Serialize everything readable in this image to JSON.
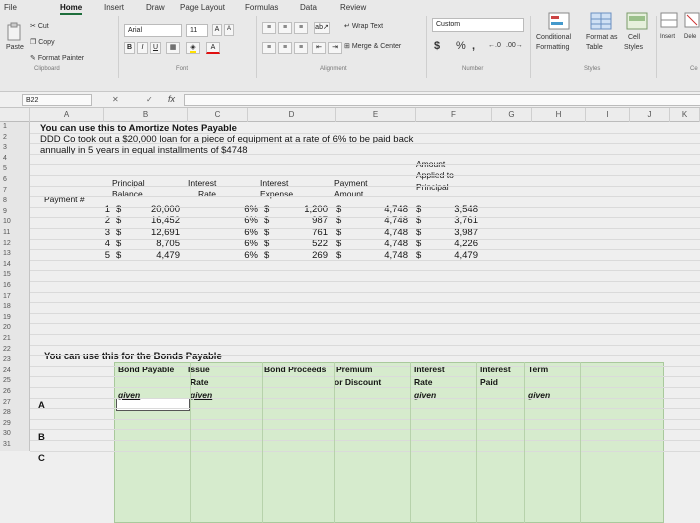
{
  "ribbon": {
    "tabs": [
      {
        "label": "File"
      },
      {
        "label": "Home"
      },
      {
        "label": "Insert"
      },
      {
        "label": "Draw"
      },
      {
        "label": "Page Layout"
      },
      {
        "label": "Formulas"
      },
      {
        "label": "Data"
      },
      {
        "label": "Review"
      }
    ],
    "clipboard": {
      "paste": "Paste",
      "cut": "Cut",
      "copy": "Copy",
      "format_painter": "Format Painter",
      "group": "Clipboard"
    },
    "font": {
      "name": "Arial",
      "size": "11",
      "bold": "B",
      "italic": "I",
      "underline": "U",
      "grow": "A",
      "shrink": "A",
      "color": "A",
      "group": "Font"
    },
    "alignment": {
      "wrap": "Wrap Text",
      "merge": "Merge & Center",
      "group": "Alignment"
    },
    "number": {
      "format": "Custom",
      "currency": "$",
      "percent": "%",
      "comma": ",",
      "group": "Number"
    },
    "styles": {
      "conditional_line1": "Conditional",
      "conditional_line2": "Formatting",
      "format_as_table_line1": "Format as",
      "format_as_table_line2": "Table",
      "cell_line1": "Cell",
      "cell_line2": "Styles",
      "group": "Styles"
    },
    "cells": {
      "insert": "Insert",
      "delete": "Dele",
      "ce": "Ce"
    }
  },
  "formula_bar": {
    "name_box": "B22",
    "fx": "fx",
    "cancel": "✕",
    "enter": "✓"
  },
  "columns": [
    "A",
    "B",
    "C",
    "D",
    "E",
    "F",
    "G",
    "H",
    "I",
    "J",
    "K"
  ],
  "rows": [
    "1",
    "2",
    "3",
    "4",
    "5",
    "6",
    "7",
    "8",
    "9",
    "10",
    "11",
    "12",
    "13",
    "14",
    "15",
    "16",
    "17",
    "18",
    "19",
    "20",
    "21",
    "22",
    "23",
    "24",
    "25",
    "26",
    "27",
    "28",
    "29",
    "30",
    "31"
  ],
  "sheet": {
    "line1": "You can use this to Amortize Notes Payable",
    "line2": "DDD Co took out a $20,000 loan for a piece of equipment at a rate of 6% to be paid back",
    "line3": "annually in 5 years in equal installments of  $4748",
    "hdr": {
      "payment_num": "Payment #",
      "principal_balance_1": "Principal",
      "principal_balance_2": "Balance",
      "interest_rate_1": "Interest",
      "interest_rate_2": "Rate",
      "interest_expense_1": "Interest",
      "interest_expense_2": "Expense",
      "payment_amount_1": "Payment",
      "payment_amount_2": "Amount",
      "applied_1": "Amount",
      "applied_2": "Applied to",
      "applied_3": "Principal"
    },
    "amort_rows": [
      {
        "n": "1",
        "bal": "20,000",
        "rate": "6%",
        "exp": "1,200",
        "pay": "4,748",
        "prin": "3,548"
      },
      {
        "n": "2",
        "bal": "16,452",
        "rate": "6%",
        "exp": "987",
        "pay": "4,748",
        "prin": "3,761"
      },
      {
        "n": "3",
        "bal": "12,691",
        "rate": "6%",
        "exp": "761",
        "pay": "4,748",
        "prin": "3,987"
      },
      {
        "n": "4",
        "bal": "8,705",
        "rate": "6%",
        "exp": "522",
        "pay": "4,748",
        "prin": "4,226"
      },
      {
        "n": "5",
        "bal": "4,479",
        "rate": "6%",
        "exp": "269",
        "pay": "4,748",
        "prin": "4,479"
      }
    ],
    "dollar": "$",
    "bonds_title": "You can use this for the Bonds Payable",
    "bonds_hdr": {
      "bond_payable": "Bond Payable",
      "issue": "Issue",
      "rate": "Rate",
      "proceeds": "Bond Proceeds",
      "premium": "Premium",
      "or_discount": "or Discount",
      "interest": "Interest",
      "interest_rate": "Rate",
      "interest_paid_1": "Interest",
      "interest_paid_2": "Paid",
      "term": "Term"
    },
    "given": "given",
    "labels": {
      "a": "A",
      "b": "B",
      "c": "C"
    }
  },
  "colors": {
    "green_fill": "#d6ebcd",
    "accent": "#1e6e3c"
  }
}
